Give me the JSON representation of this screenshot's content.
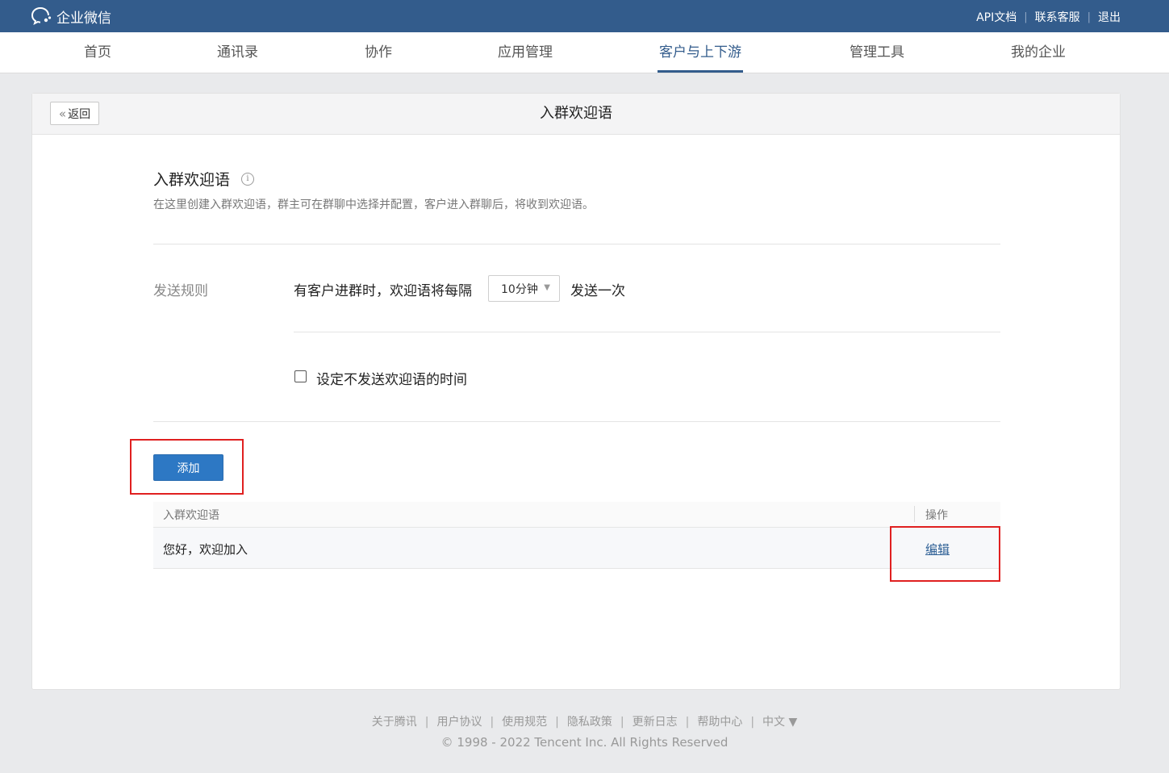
{
  "app": {
    "name": "企业微信"
  },
  "topbar": {
    "links": [
      "API文档",
      "联系客服",
      "退出"
    ]
  },
  "nav": {
    "items": [
      "首页",
      "通讯录",
      "协作",
      "应用管理",
      "客户与上下游",
      "管理工具",
      "我的企业"
    ],
    "active": "客户与上下游"
  },
  "card": {
    "back_label": "返回",
    "title": "入群欢迎语"
  },
  "section": {
    "title": "入群欢迎语",
    "description": "在这里创建入群欢迎语，群主可在群聊中选择并配置，客户进入群聊后，将收到欢迎语。"
  },
  "rule": {
    "label": "发送规则",
    "text": "有客户进群时，欢迎语将每隔",
    "interval": "10分钟",
    "suffix": "发送一次",
    "checkbox_label": "设定不发送欢迎语的时间",
    "checkbox_checked": false
  },
  "add_button": "添加",
  "table": {
    "columns": [
      "入群欢迎语",
      "操作"
    ],
    "rows": [
      {
        "name": "您好，欢迎加入",
        "action": "编辑"
      }
    ]
  },
  "footer": {
    "links": [
      "关于腾讯",
      "用户协议",
      "使用规范",
      "隐私政策",
      "更新日志",
      "帮助中心",
      "中文 ▼"
    ],
    "copyright": "© 1998 - 2022 Tencent Inc. All Rights Reserved"
  },
  "colors": {
    "topbar": "#335c8c",
    "accent": "#2d78c4",
    "highlight": "#e02020",
    "page_bg": "#e9eaec"
  }
}
